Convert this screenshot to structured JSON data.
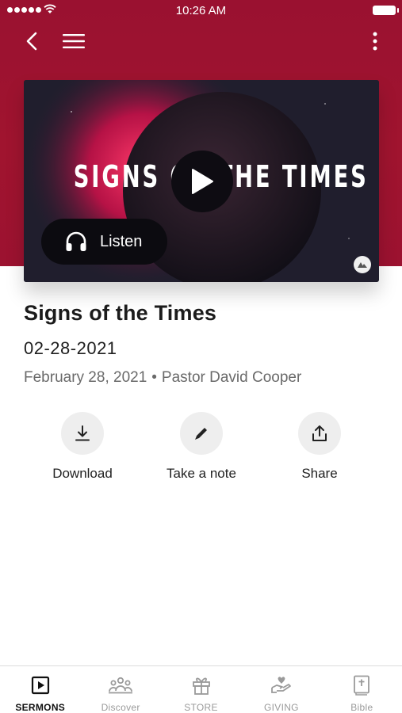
{
  "status_bar": {
    "time": "10:26 AM"
  },
  "nav": {
    "back_icon": "chevron-left-icon",
    "menu_icon": "hamburger-menu-icon",
    "more_icon": "more-vertical-icon"
  },
  "artwork": {
    "title": "SIGNS OF THE TIMES",
    "play_icon": "play-icon",
    "listen_label": "Listen",
    "logo_icon": "church-logo-icon"
  },
  "sermon": {
    "title": "Signs of the Times",
    "date_short": "02-28-2021",
    "date_long": "February 28, 2021",
    "separator": "•",
    "speaker": "Pastor David Cooper"
  },
  "actions": [
    {
      "label": "Download",
      "icon": "download-icon"
    },
    {
      "label": "Take a note",
      "icon": "pencil-icon"
    },
    {
      "label": "Share",
      "icon": "share-icon"
    }
  ],
  "tabs": [
    {
      "label": "SERMONS",
      "icon": "play-square-icon",
      "active": true
    },
    {
      "label": "Discover",
      "icon": "people-group-icon",
      "active": false
    },
    {
      "label": "STORE",
      "icon": "gift-icon",
      "active": false
    },
    {
      "label": "GIVING",
      "icon": "giving-hand-icon",
      "active": false
    },
    {
      "label": "Bible",
      "icon": "bible-icon",
      "active": false
    }
  ],
  "colors": {
    "header_red": "#9d1230",
    "active_tab": "#111111",
    "inactive_tab": "#9a9a9a",
    "action_circle": "#eeeeee"
  }
}
